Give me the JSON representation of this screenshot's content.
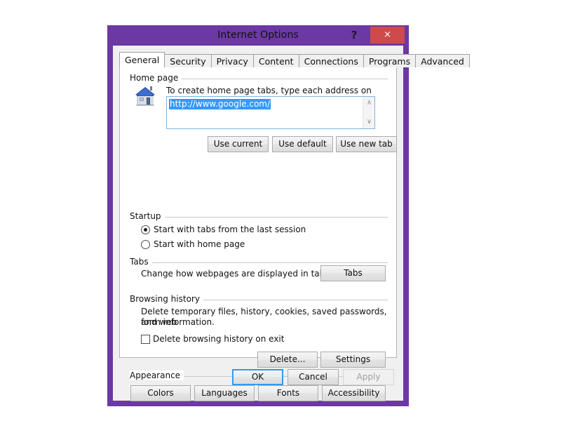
{
  "window": {
    "title": "Internet Options",
    "help_label": "?",
    "close_label": "×",
    "frame_color": "#6c38a4",
    "close_color": "#cf4a4a"
  },
  "tabs": [
    {
      "label": "General",
      "active": true
    },
    {
      "label": "Security",
      "active": false
    },
    {
      "label": "Privacy",
      "active": false
    },
    {
      "label": "Content",
      "active": false
    },
    {
      "label": "Connections",
      "active": false
    },
    {
      "label": "Programs",
      "active": false
    },
    {
      "label": "Advanced",
      "active": false
    }
  ],
  "home_page": {
    "group_label": "Home page",
    "icon": "house-icon",
    "description": "To create home page tabs, type each address on its own line.",
    "value": "http://www.google.com/",
    "selected": true,
    "scroll_up": "∧",
    "scroll_down": "∨",
    "buttons": [
      {
        "label": "Use current"
      },
      {
        "label": "Use default"
      },
      {
        "label": "Use new tab"
      }
    ]
  },
  "startup": {
    "group_label": "Startup",
    "options": [
      {
        "label": "Start with tabs from the last session",
        "checked": true
      },
      {
        "label": "Start with home page",
        "checked": false
      }
    ]
  },
  "tabs_section": {
    "group_label": "Tabs",
    "description": "Change how webpages are displayed in tabs.",
    "button": {
      "label": "Tabs"
    }
  },
  "browsing_history": {
    "group_label": "Browsing history",
    "description_line1": "Delete temporary files, history, cookies, saved passwords, and web",
    "description_line2": "form information.",
    "checkbox": {
      "label": "Delete browsing history on exit",
      "checked": false
    },
    "buttons": [
      {
        "label": "Delete..."
      },
      {
        "label": "Settings"
      }
    ]
  },
  "appearance": {
    "group_label": "Appearance",
    "buttons": [
      {
        "label": "Colors"
      },
      {
        "label": "Languages"
      },
      {
        "label": "Fonts"
      },
      {
        "label": "Accessibility"
      }
    ]
  },
  "actions": {
    "ok": {
      "label": "OK",
      "focused": true,
      "enabled": true
    },
    "cancel": {
      "label": "Cancel",
      "enabled": true
    },
    "apply": {
      "label": "Apply",
      "enabled": false
    }
  }
}
